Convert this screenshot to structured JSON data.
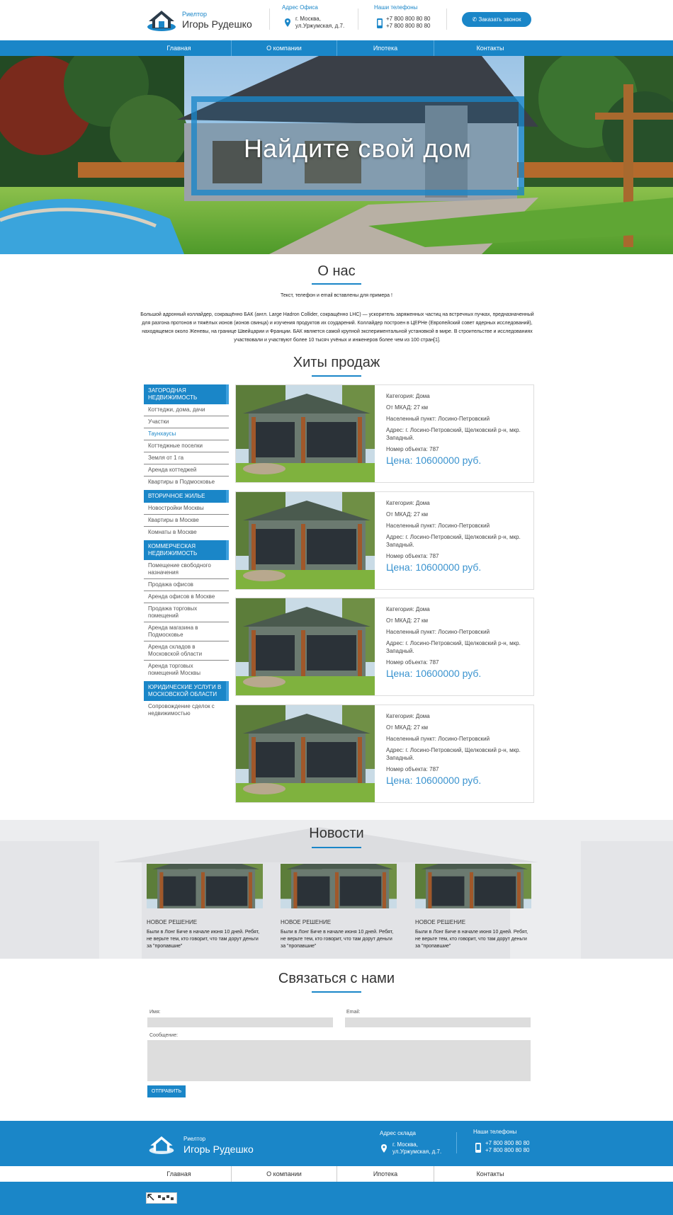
{
  "header": {
    "logo_small": "Риелтор",
    "logo_big": "Игорь Рудешко",
    "office_title": "Адрес Офиса",
    "office_line1": "г. Москва,",
    "office_line2": "ул.Уржумская, д.7.",
    "phones_title": "Наши телефоны",
    "phone1": "+7 800 800 80 80",
    "phone2": "+7 800 800 80 80",
    "call_button": "Заказать звонок"
  },
  "menu": [
    "Главная",
    "О компании",
    "Ипотека",
    "Контакты"
  ],
  "hero": {
    "title": "Найдите свой дом"
  },
  "about": {
    "title": "О нас",
    "lead": "Текст, телефон и email вставлены для примера !",
    "text": "Большой адронный коллайдер, сокращённо БАК (англ. Large Hadron Collider, сокращённо LHC) — ускоритель заряженных частиц на встречных пучках, предназначенный для разгона протонов и тяжёлых ионов (ионов свинца) и изучения продуктов их соударений. Коллайдер построен в ЦЕРНе (Европейский совет ядерных исследований), находящемся около Женевы, на границе Швейцарии и Франции. БАК является самой крупной экспериментальной установкой в мире. В строительстве и исследованиях участвовали и участвуют более 10 тысяч учёных и инженеров более чем из 100 стран[1]."
  },
  "hits": {
    "title": "Хиты продаж"
  },
  "sidebar": [
    {
      "head": "ЗАГОРОДНАЯ НЕДВИЖИМОСТЬ",
      "items": [
        "Коттеджи, дома, дачи",
        "Участки",
        "Таунхаусы",
        "Коттеджные поселки",
        "Земля от 1 га",
        "Аренда коттеджей",
        "Квартиры в Подмосковье"
      ],
      "active": 2
    },
    {
      "head": "ВТОРИЧНОЕ ЖИЛЬЕ",
      "items": [
        "Новостройки Москвы",
        "Квартиры в Москве",
        "Комнаты в Москве"
      ],
      "active": -1
    },
    {
      "head": "КОММЕРЧЕСКАЯ НЕДВИЖИМОСТЬ",
      "items": [
        "Помещение свободного назначения",
        "Продажа офисов",
        "Аренда офисов в Москве",
        "Продажа торговых помещений",
        "Аренда магазина в Подмосковье",
        "Аренда складов в Московской области",
        "Аренда торговых помещений Москвы"
      ],
      "active": -1
    },
    {
      "head": "ЮРИДИЧЕСКИЕ УСЛУГИ В МОСКОВСКОЙ ОБЛАСТИ",
      "items": [
        "Сопровождение сделок с недвижимостью"
      ],
      "active": -1
    }
  ],
  "products": [
    {
      "category": "Категория: Дома",
      "mkad": "От МКАД: 27 км",
      "locality": "Населенный пункт: Лосино-Петровский",
      "address": "Адрес: г. Лосино-Петровский, Щелковский р-н, мкр. Западный.",
      "number": "Номер объекта: 787",
      "price": "Цена: 10600000 руб."
    },
    {
      "category": "Категория: Дома",
      "mkad": "От МКАД: 27 км",
      "locality": "Населенный пункт: Лосино-Петровский",
      "address": "Адрес: г. Лосино-Петровский, Щелковский р-н, мкр. Западный.",
      "number": "Номер объекта: 787",
      "price": "Цена: 10600000 руб."
    },
    {
      "category": "Категория: Дома",
      "mkad": "От МКАД: 27 км",
      "locality": "Населенный пункт: Лосино-Петровский",
      "address": "Адрес: г. Лосино-Петровский, Щелковский р-н, мкр. Западный.",
      "number": "Номер объекта: 787",
      "price": "Цена: 10600000 руб."
    },
    {
      "category": "Категория: Дома",
      "mkad": "От МКАД: 27 км",
      "locality": "Населенный пункт: Лосино-Петровский",
      "address": "Адрес: г. Лосино-Петровский, Щелковский р-н, мкр. Западный.",
      "number": "Номер объекта: 787",
      "price": "Цена: 10600000 руб."
    }
  ],
  "news": {
    "title": "Новости",
    "items": [
      {
        "title": "НОВОЕ РЕШЕНИЕ",
        "text": "Были в Лонг Биче в начале июня 10 дней. Ребят, не верьте тем, кто говорит, что там дорут деньги за \"пропавшие\""
      },
      {
        "title": "НОВОЕ РЕШЕНИЕ",
        "text": "Были в Лонг Биче в начале июня 10 дней. Ребят, не верьте тем, кто говорит, что там дорут деньги за \"пропавшие\""
      },
      {
        "title": "НОВОЕ РЕШЕНИЕ",
        "text": "Были в Лонг Биче в начале июня 10 дней. Ребят, не верьте тем, кто говорит, что там дорут деньги за \"пропавшие\""
      }
    ]
  },
  "contact": {
    "title": "Связаться с нами",
    "name_label": "Имя:",
    "email_label": "Email:",
    "message_label": "Сообщение:",
    "submit": "ОТПРАВИТЬ"
  },
  "footer": {
    "logo_small": "Риелтор",
    "logo_big": "Игорь Рудешко",
    "warehouse_title": "Адрес склада",
    "address_line1": "г. Москва,",
    "address_line2": "ул.Уржумская, д.7.",
    "phones_title": "Наши телефоны",
    "phone1": "+7 800 800 80 80",
    "phone2": "+7 800 800 80 80"
  },
  "footer_menu": [
    "Главная",
    "О компании",
    "Ипотека",
    "Контакты"
  ],
  "colors": {
    "accent": "#1a86c8",
    "price": "#3a93cf"
  }
}
